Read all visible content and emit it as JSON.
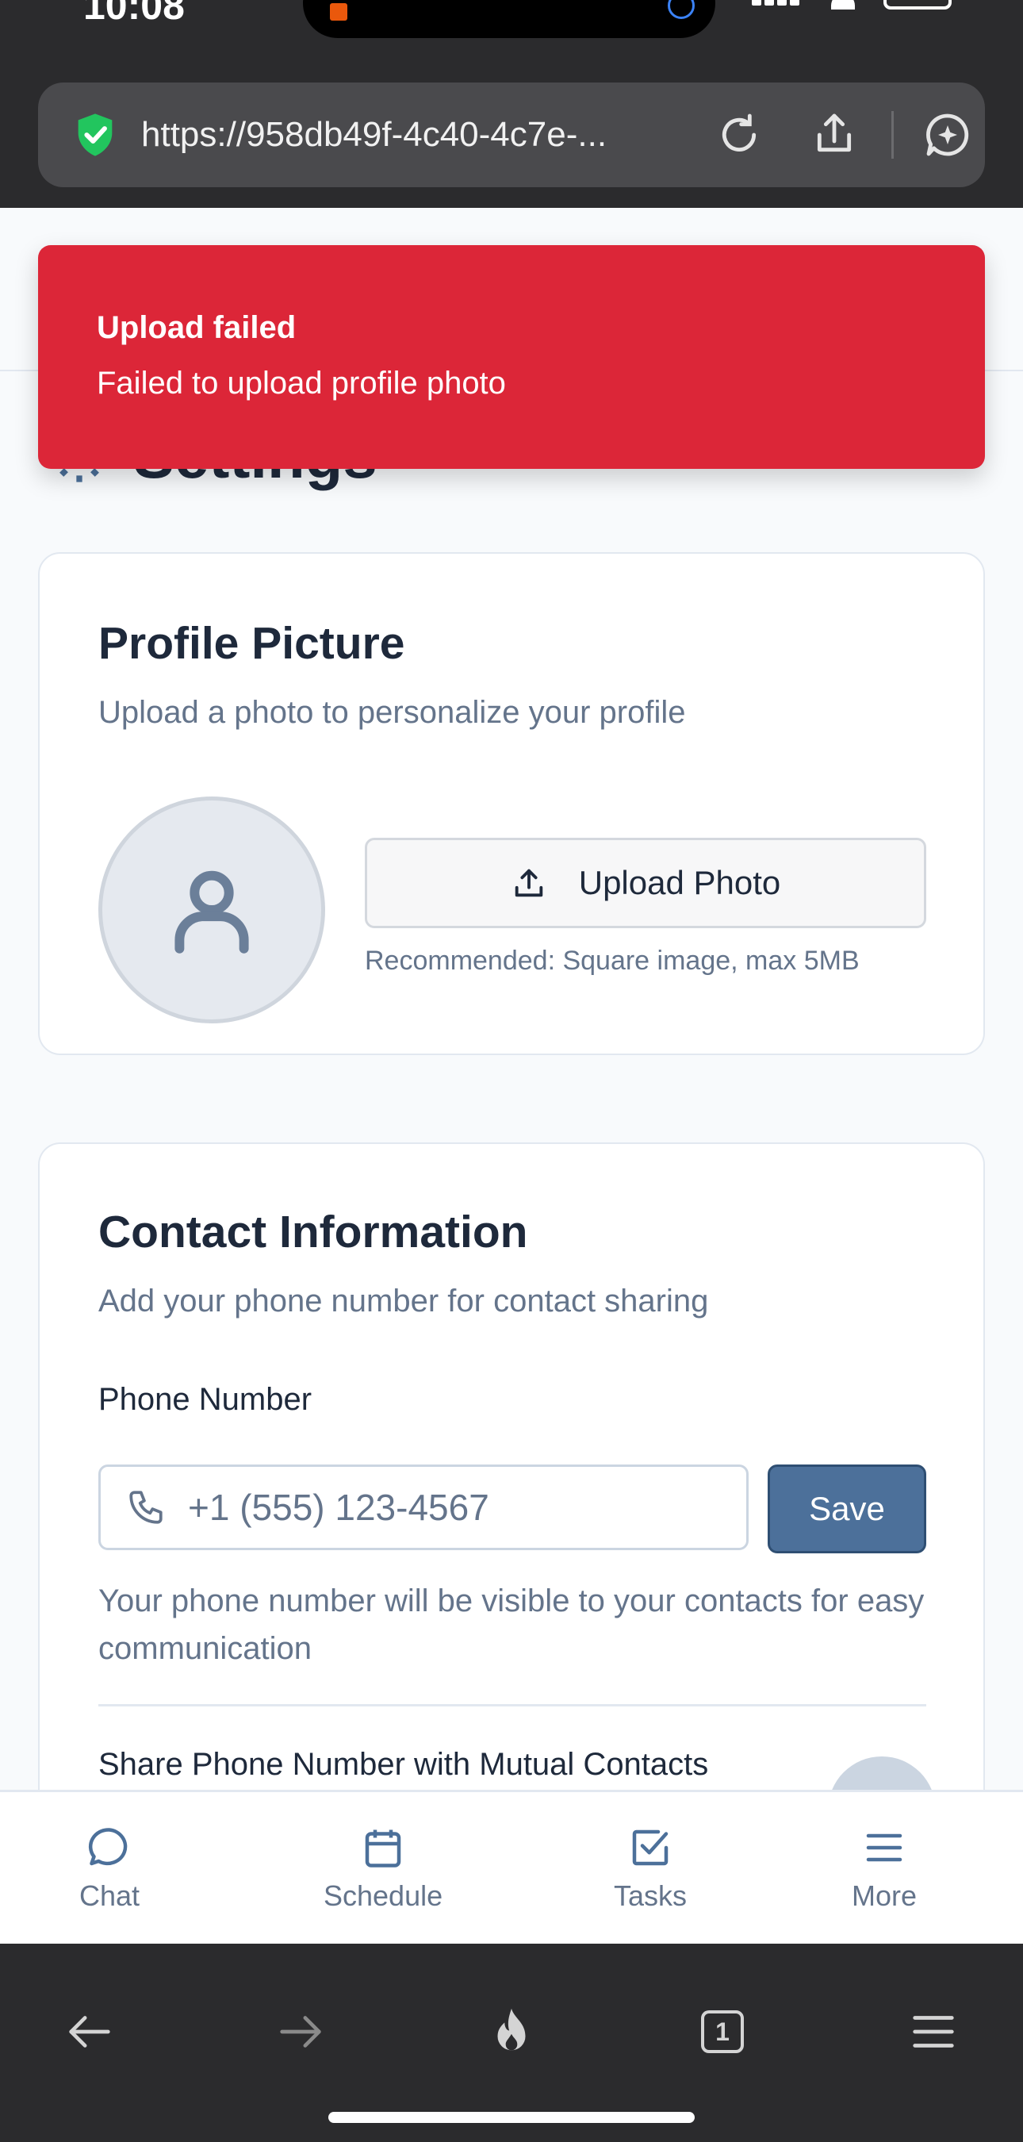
{
  "status_bar": {
    "time": "10:08"
  },
  "url_bar": {
    "url": "https://958db49f-4c40-4c7e-..."
  },
  "page": {
    "title": "Settings"
  },
  "profile_card": {
    "title": "Profile Picture",
    "subtitle": "Upload a photo to personalize your profile",
    "upload_label": "Upload Photo",
    "hint": "Recommended: Square image, max 5MB"
  },
  "contact_card": {
    "title": "Contact Information",
    "subtitle": "Add your phone number for contact sharing",
    "phone_label": "Phone Number",
    "phone_placeholder": "+1 (555) 123-4567",
    "phone_value": "",
    "save_label": "Save",
    "help_text": "Your phone number will be visible to your contacts for easy communication",
    "share_label": "Share Phone Number with Mutual Contacts"
  },
  "bottom_nav": {
    "items": [
      {
        "label": "Chat",
        "icon": "chat-bubble-icon"
      },
      {
        "label": "Schedule",
        "icon": "calendar-icon"
      },
      {
        "label": "Tasks",
        "icon": "checkbox-icon"
      },
      {
        "label": "More",
        "icon": "menu-icon"
      }
    ]
  },
  "toast": {
    "title": "Upload failed",
    "message": "Failed to upload profile photo",
    "color": "#dc2638"
  },
  "browser_toolbar": {
    "tab_count": "1"
  },
  "colors": {
    "primary": "#4c709a",
    "muted_text": "#64748b",
    "secure": "#22c55e"
  }
}
